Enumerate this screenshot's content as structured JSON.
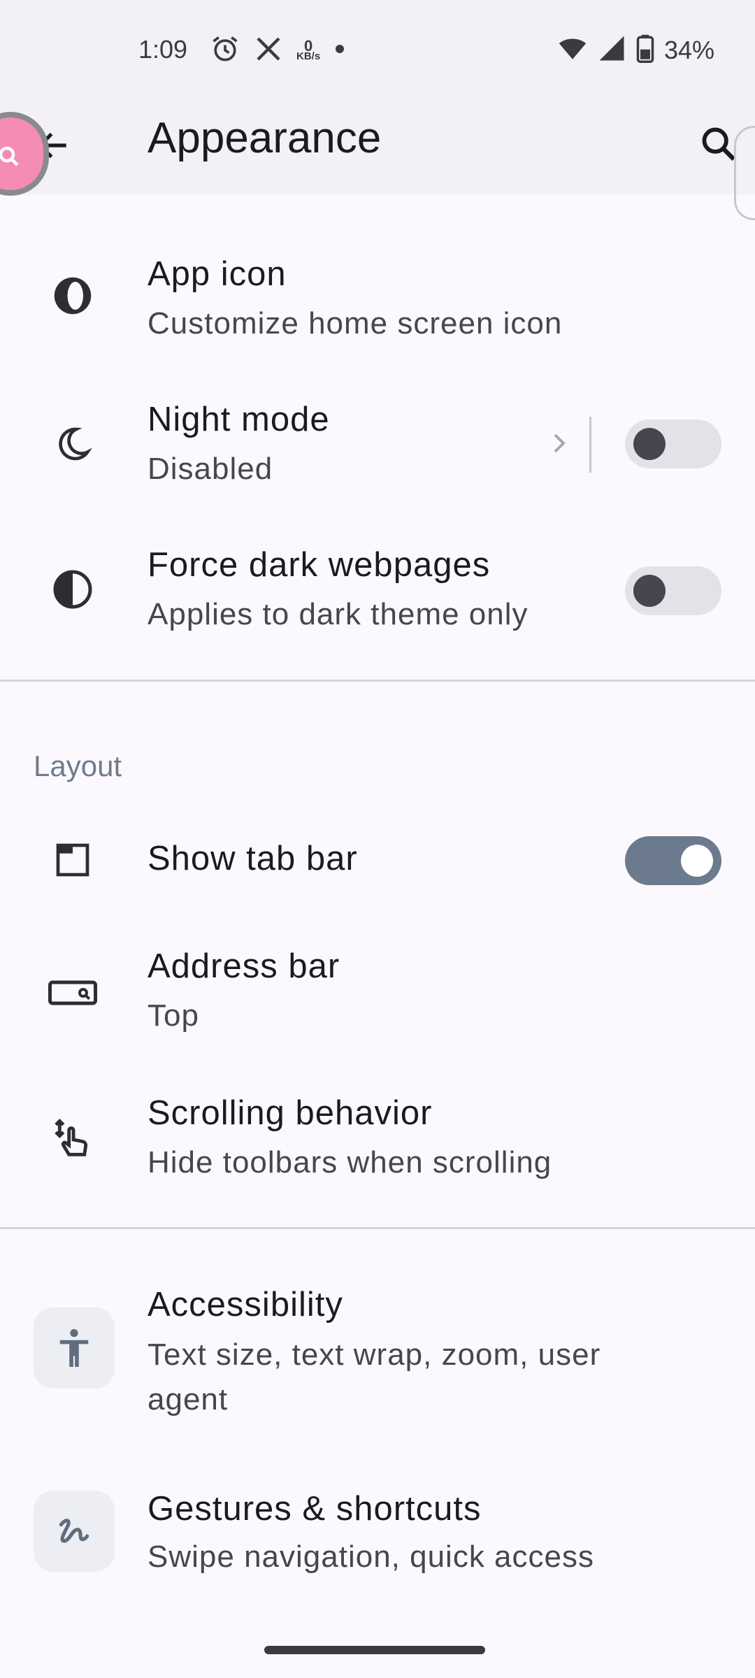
{
  "status_bar": {
    "time": "1:09",
    "speed_value": "0",
    "speed_unit": "KB/s",
    "battery": "34%"
  },
  "app_bar": {
    "title": "Appearance"
  },
  "rows": {
    "app_icon": {
      "title": "App icon",
      "subtitle": "Customize home screen icon"
    },
    "night_mode": {
      "title": "Night mode",
      "subtitle": "Disabled",
      "enabled": false
    },
    "force_dark": {
      "title": "Force dark webpages",
      "subtitle": "Applies to dark theme only",
      "enabled": false
    },
    "show_tab_bar": {
      "title": "Show tab bar",
      "enabled": true
    },
    "address_bar": {
      "title": "Address bar",
      "subtitle": "Top"
    },
    "scrolling": {
      "title": "Scrolling behavior",
      "subtitle": "Hide toolbars when scrolling"
    },
    "accessibility": {
      "title": "Accessibility",
      "subtitle": "Text size, text wrap, zoom, user agent"
    },
    "gestures": {
      "title": "Gestures & shortcuts",
      "subtitle": "Swipe navigation, quick access"
    }
  },
  "sections": {
    "layout": "Layout"
  },
  "colors": {
    "accent": "#6b7a8c",
    "background": "#fbf9fd",
    "bubble": "#f48cb4"
  }
}
